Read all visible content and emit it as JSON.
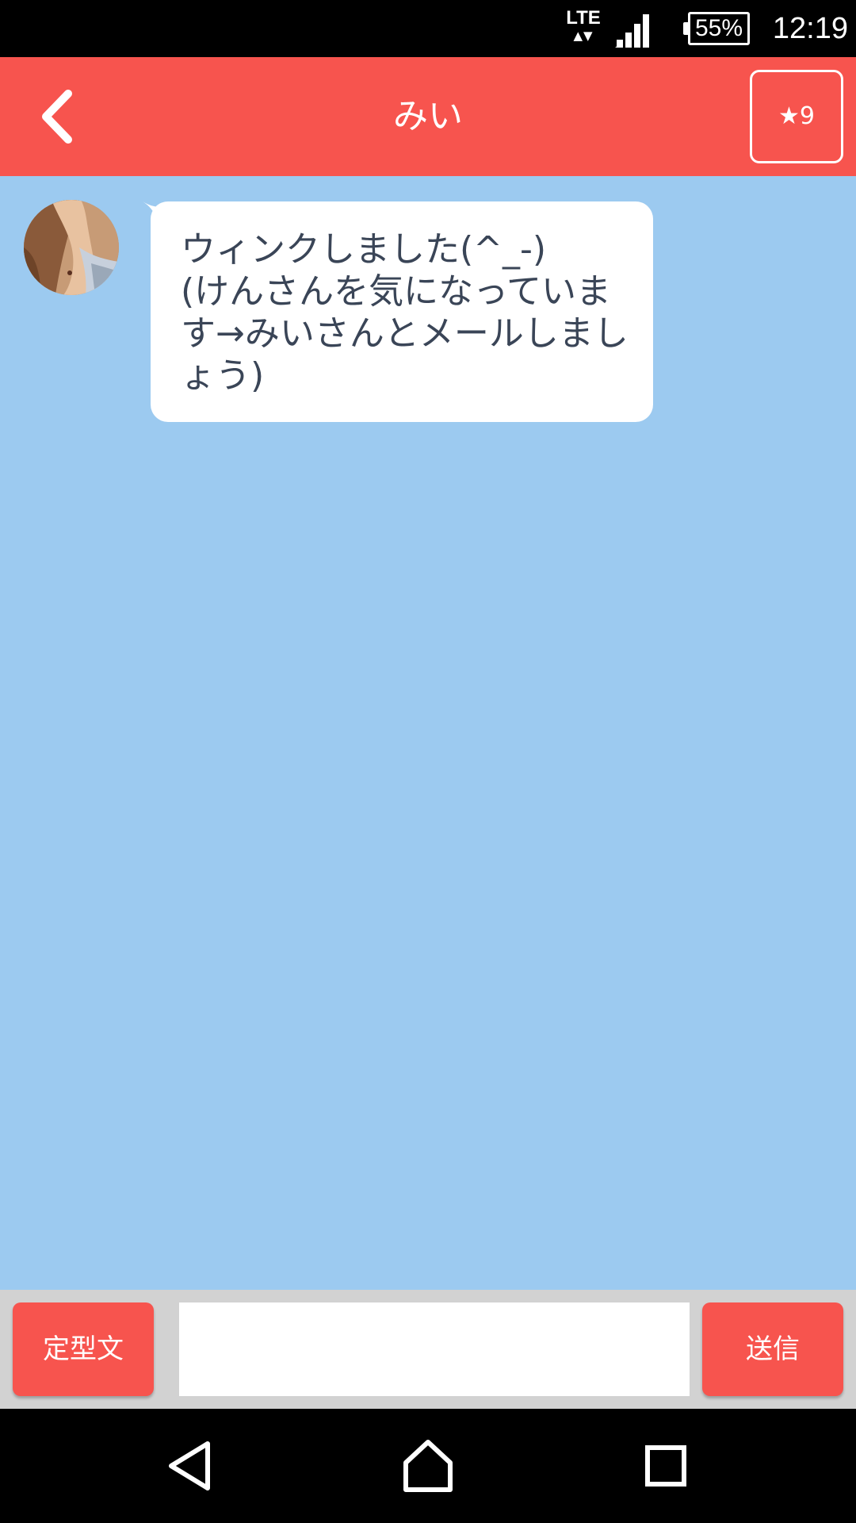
{
  "status_bar": {
    "network": "LTE",
    "network_arrows": "▲▼",
    "battery": "55%",
    "time": "12:19"
  },
  "header": {
    "title": "みい",
    "star_label": "★9"
  },
  "chat": {
    "messages": [
      {
        "sender": "みい",
        "text": "ウィンクしました(^_-)\n(けんさんを気になっています→みいさんとメールしましょう)"
      }
    ]
  },
  "input_bar": {
    "template_label": "定型文",
    "message_value": "",
    "send_label": "送信"
  },
  "colors": {
    "accent": "#f7544e",
    "chat_background": "#9ccaf0",
    "bubble_text": "#3a4557"
  },
  "icons": {
    "back": "chevron-left-icon",
    "nav_back": "triangle-back-icon",
    "nav_home": "home-icon",
    "nav_recents": "square-recents-icon"
  }
}
